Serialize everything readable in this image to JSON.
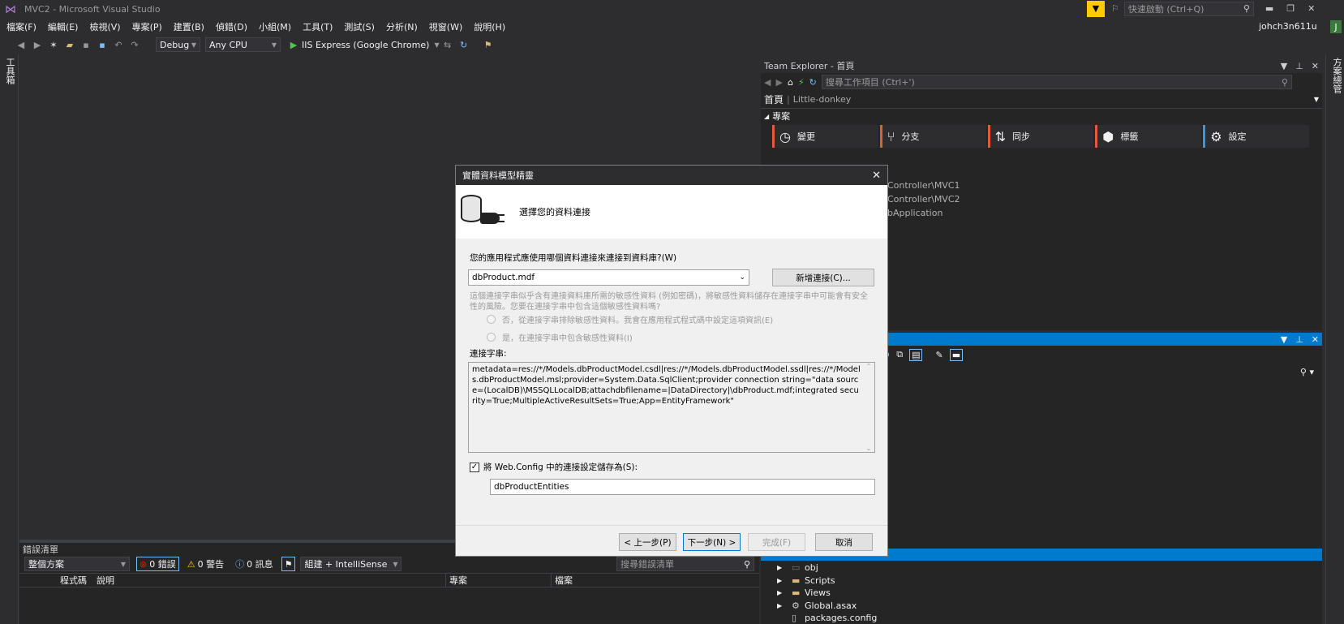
{
  "window": {
    "title": "MVC2 - Microsoft Visual Studio",
    "quick_launch_placeholder": "快速啟動 (Ctrl+Q)",
    "user": "johch3n611u",
    "user_initial": "J"
  },
  "menu": [
    "檔案(F)",
    "編輯(E)",
    "檢視(V)",
    "專案(P)",
    "建置(B)",
    "偵錯(D)",
    "小組(M)",
    "工具(T)",
    "測試(S)",
    "分析(N)",
    "視窗(W)",
    "說明(H)"
  ],
  "toolbar": {
    "config": "Debug",
    "platform": "Any CPU",
    "run_target": "IIS Express (Google Chrome)"
  },
  "left_strip": {
    "label": "工具箱"
  },
  "right_strip": {
    "label": "方案總管"
  },
  "team_explorer": {
    "title": "Team Explorer - 首頁",
    "search_placeholder": "搜尋工作項目 (Ctrl+')",
    "home_label": "首頁",
    "repo": "Little-donkey",
    "section": "專案",
    "tiles": [
      {
        "label": "變更",
        "icon": "clock-icon"
      },
      {
        "label": "分支",
        "icon": "branch-icon"
      },
      {
        "label": "同步",
        "icon": "sync-icon"
      },
      {
        "label": "標籤",
        "icon": "tag-icon"
      },
      {
        "label": "設定",
        "icon": "gear-icon"
      }
    ],
    "partial_items": [
      "Controller\\MVC1",
      "Controller\\MVC2",
      "bApplication"
    ]
  },
  "solution_explorer": {
    "items": [
      {
        "label": "obj",
        "type": "folder"
      },
      {
        "label": "Scripts",
        "type": "folder"
      },
      {
        "label": "Views",
        "type": "folder"
      },
      {
        "label": "Global.asax",
        "type": "file"
      },
      {
        "label": "packages.config",
        "type": "file"
      }
    ]
  },
  "error_list": {
    "title": "錯誤清單",
    "scope": "整個方案",
    "errors": "0 錯誤",
    "warnings": "0 警告",
    "messages": "0 訊息",
    "build_filter": "組建 + IntelliSense",
    "search_placeholder": "搜尋錯誤清單",
    "columns": [
      "程式碼",
      "說明",
      "專案",
      "檔案"
    ]
  },
  "dialog": {
    "title": "實體資料模型精靈",
    "banner": "選擇您的資料連接",
    "question": "您的應用程式應使用哪個資料連接來連接到資料庫?(W)",
    "connection": "dbProduct.mdf",
    "new_connection": "新增連接(C)...",
    "warning": "這個連接字串似乎含有連接資料庫所需的敏感性資料 (例如密碼)，將敏感性資料儲存在連接字串中可能會有安全性的風險。您要在連接字串中包含這個敏感性資料嗎?",
    "radio_no": "否，從連接字串排除敏感性資料。我會在應用程式程式碼中設定這項資訊(E)",
    "radio_yes": "是，在連接字串中包含敏感性資料(I)",
    "conn_string_label": "連接字串:",
    "conn_string": "metadata=res://*/Models.dbProductModel.csdl|res://*/Models.dbProductModel.ssdl|res://*/Models.dbProductModel.msl;provider=System.Data.SqlClient;provider connection string=\"data source=(LocalDB)\\MSSQLLocalDB;attachdbfilename=|DataDirectory|\\dbProduct.mdf;integrated security=True;MultipleActiveResultSets=True;App=EntityFramework\"",
    "save_checkbox": "將 Web.Config 中的連接設定儲存為(S):",
    "save_checked": true,
    "entity_name": "dbProductEntities",
    "buttons": {
      "back": "< 上一步(P)",
      "next": "下一步(N) >",
      "finish": "完成(F)",
      "cancel": "取消"
    }
  }
}
